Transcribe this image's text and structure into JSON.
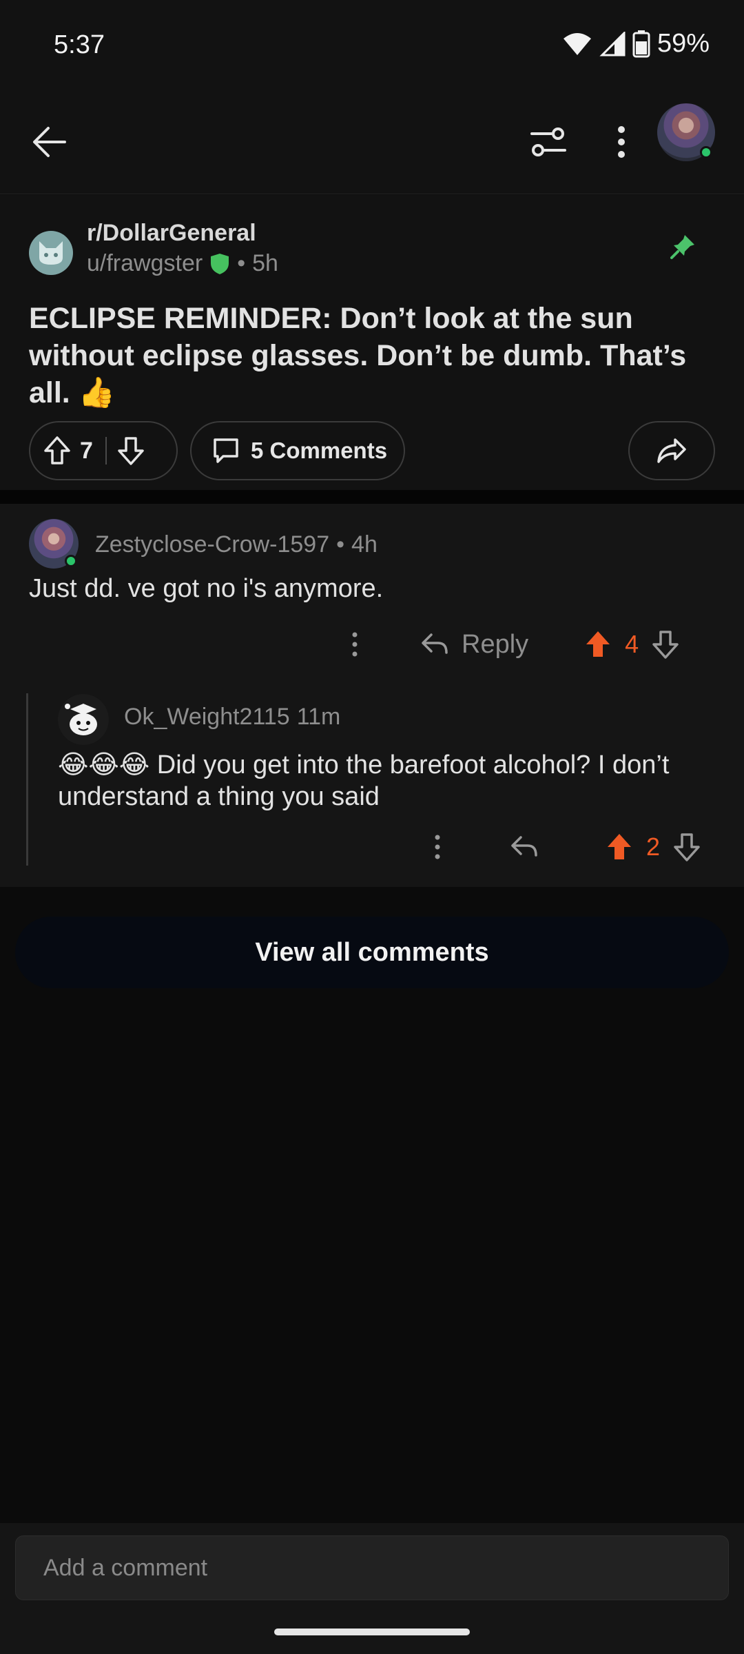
{
  "status_bar": {
    "time": "5:37",
    "battery": "59%"
  },
  "post": {
    "subreddit": "r/DollarGeneral",
    "author": "u/frawgster",
    "age": "5h",
    "title": "ECLIPSE REMINDER: Don’t look at the sun without eclipse glasses. Don’t be dumb. That’s all. 👍",
    "votes": "7",
    "comments_label": "5 Comments"
  },
  "comments": [
    {
      "author": "Zestyclose-Crow-1597",
      "age": "4h",
      "body": "Just dd. ve got no i's anymore.",
      "reply_label": "Reply",
      "votes": "4"
    },
    {
      "author": "Ok_Weight2115",
      "age": "11m",
      "body": "😂😂😂 Did you get into the barefoot alcohol? I don’t understand a thing you said",
      "votes": "2"
    }
  ],
  "view_all_label": "View all comments",
  "composer": {
    "placeholder": "Add a comment"
  },
  "colors": {
    "upvote": "#f05a24",
    "online": "#2bc46a",
    "pin": "#4cc36b",
    "shield": "#46c15f"
  },
  "icons": [
    "back-arrow-icon",
    "filter-icon",
    "more-vertical-icon",
    "pin-icon",
    "shield-icon",
    "upvote-icon",
    "downvote-icon",
    "comment-bubble-icon",
    "share-icon",
    "reply-icon"
  ]
}
